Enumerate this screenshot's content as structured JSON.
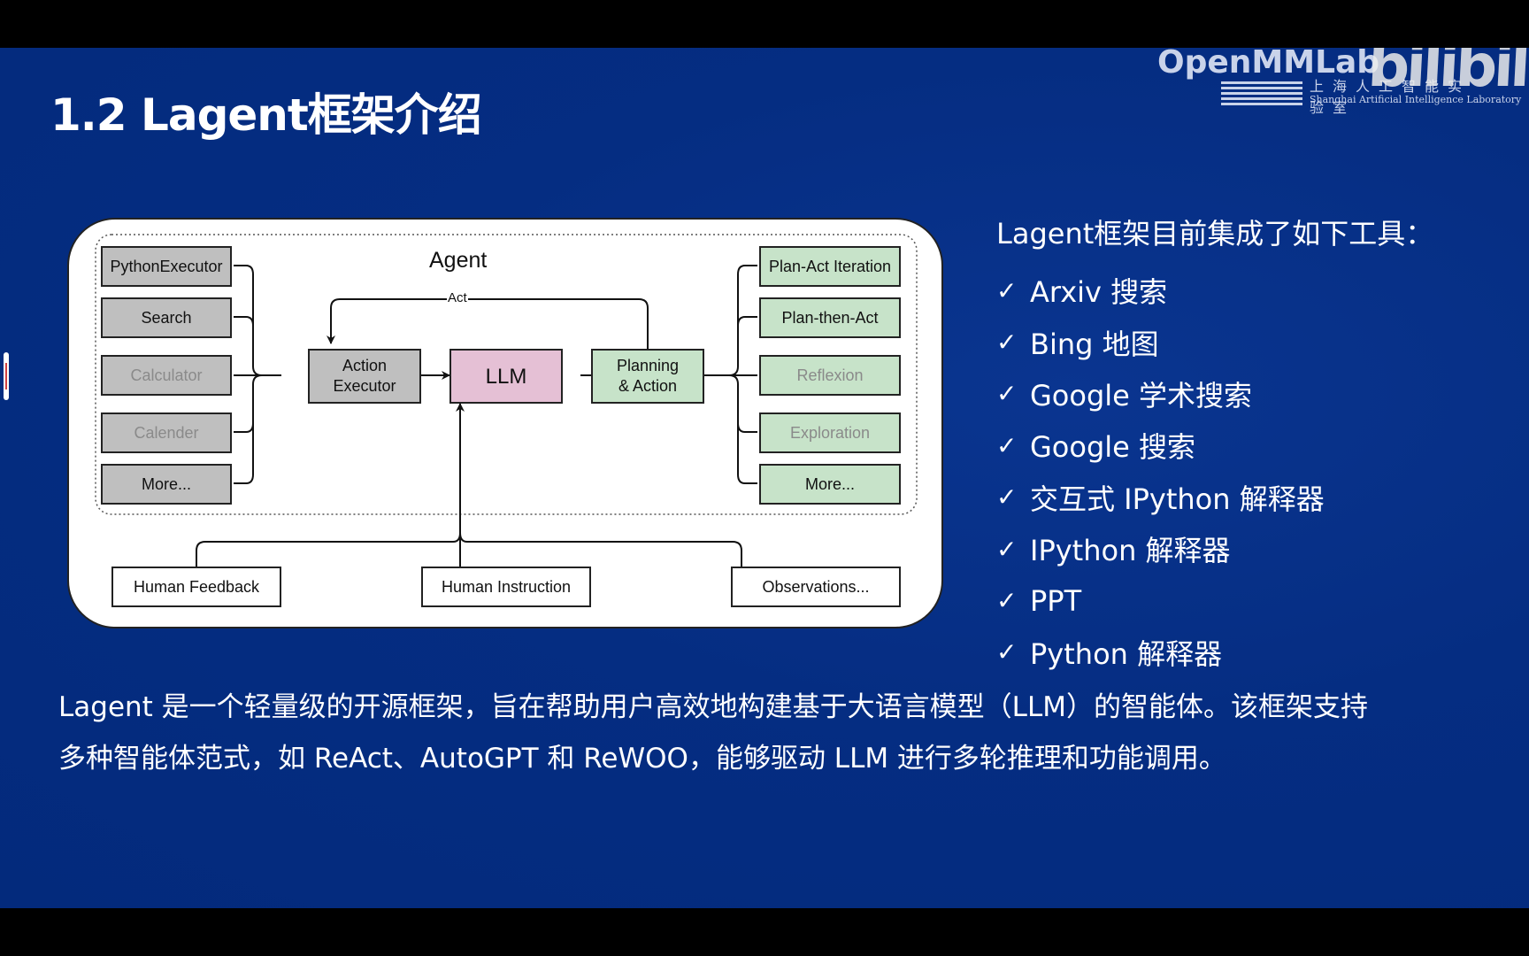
{
  "slide": {
    "title": "1.2 Lagent框架介绍",
    "branding": {
      "openmmlab": "OpenMMLab",
      "shlab_cn": "上海人工智能实验室",
      "shlab_en": "Shanghai Artificial Intelligence Laboratory",
      "bilibili": "bilibili"
    },
    "colors": {
      "background": "#052d82",
      "tool_box_gray": "#bfbfbf",
      "planning_box_green": "#c7e3c9",
      "llm_box_pink": "#e5c0d5"
    }
  },
  "diagram": {
    "agent_label": "Agent",
    "act_label": "Act",
    "tools": [
      {
        "label": "PythonExecutor",
        "faded": false
      },
      {
        "label": "Search",
        "faded": false
      },
      {
        "label": "Calculator",
        "faded": true
      },
      {
        "label": "Calender",
        "faded": true
      },
      {
        "label": "More...",
        "faded": false
      }
    ],
    "action_executor": "Action\nExecutor",
    "llm": "LLM",
    "planning": "Planning\n& Action",
    "strategies": [
      {
        "label": "Plan-Act Iteration",
        "faded": false
      },
      {
        "label": "Plan-then-Act",
        "faded": false
      },
      {
        "label": "Reflexion",
        "faded": true
      },
      {
        "label": "Exploration",
        "faded": true
      },
      {
        "label": "More...",
        "faded": false
      }
    ],
    "inputs": [
      "Human Feedback",
      "Human Instruction",
      "Observations..."
    ]
  },
  "tools_list": {
    "heading": "Lagent框架目前集成了如下工具：",
    "check_icon": "✓",
    "items": [
      "Arxiv 搜索",
      "Bing 地图",
      "Google 学术搜索",
      "Google 搜索",
      "交互式 IPython 解释器",
      "IPython 解释器",
      "PPT",
      "Python 解释器"
    ]
  },
  "description": {
    "line1": "Lagent 是一个轻量级的开源框架，旨在帮助用户高效地构建基于大语言模型（LLM）的智能体。该框架支持",
    "line2": "多种智能体范式，如 ReAct、AutoGPT 和 ReWOO，能够驱动 LLM 进行多轮推理和功能调用。"
  }
}
